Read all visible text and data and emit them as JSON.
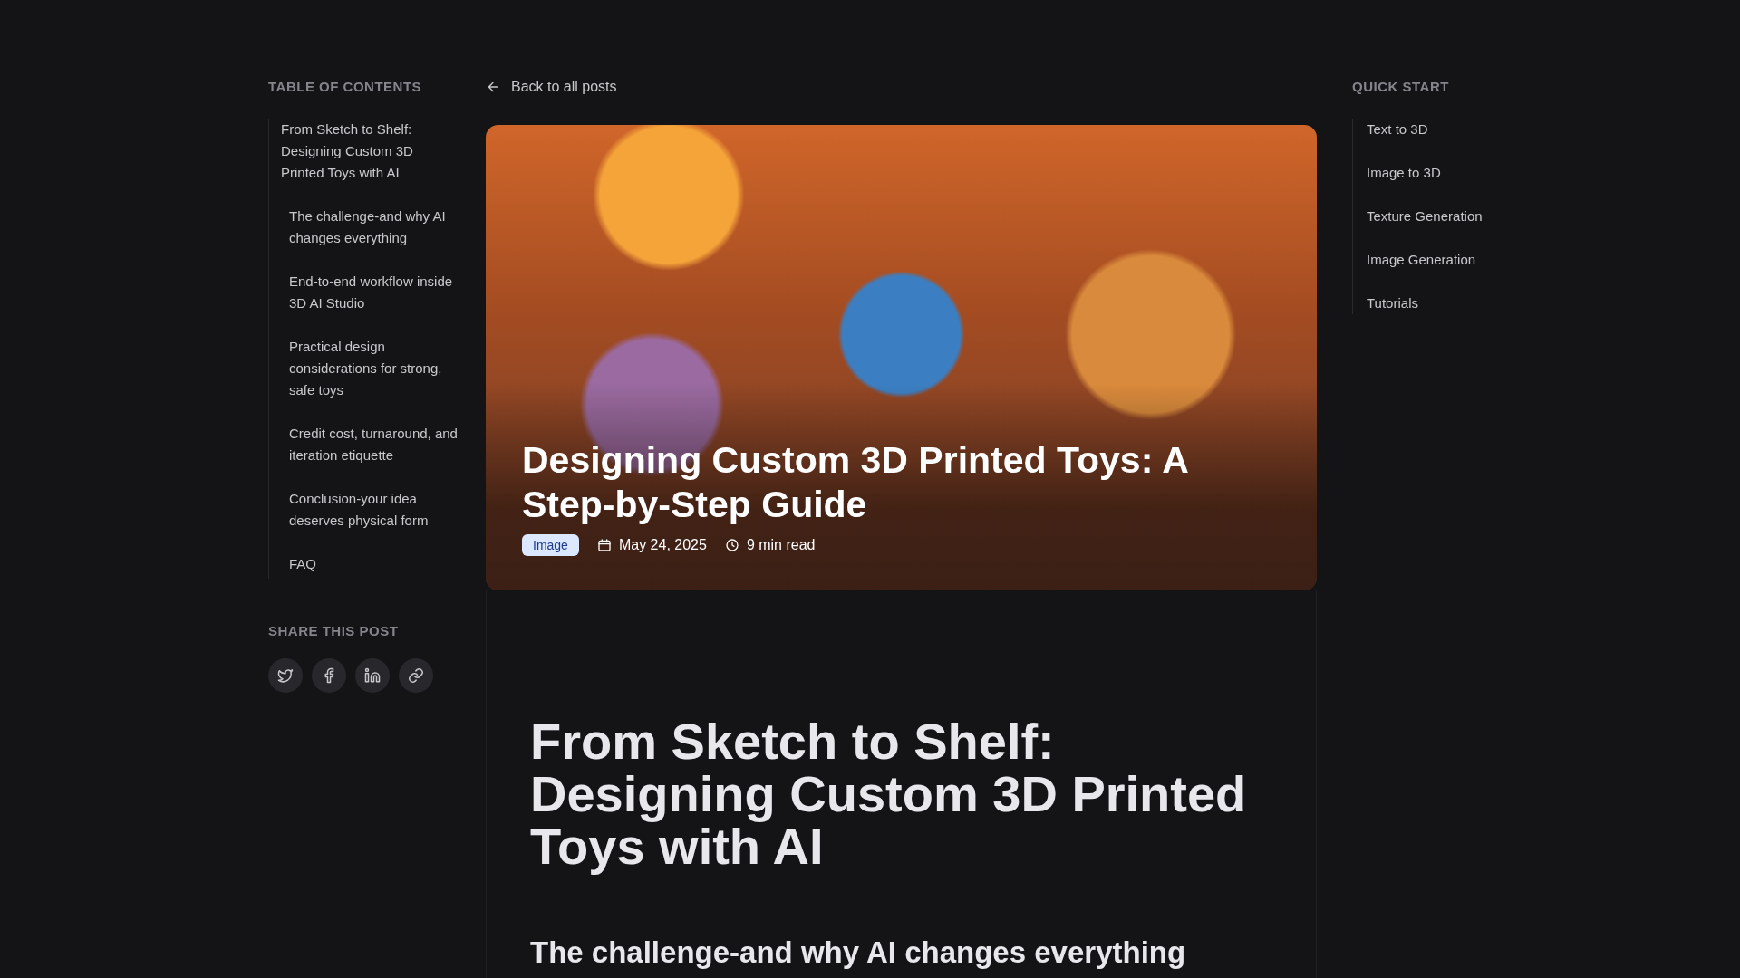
{
  "toc": {
    "title": "TABLE OF CONTENTS",
    "items": [
      {
        "label": "From Sketch to Shelf: Designing Custom 3D Printed Toys with AI",
        "children": [
          {
            "label": "The challenge-and why AI changes everything"
          },
          {
            "label": "End-to-end workflow inside 3D AI Studio"
          },
          {
            "label": "Practical design considerations for strong, safe toys"
          },
          {
            "label": "Credit cost, turnaround, and iteration etiquette"
          },
          {
            "label": "Conclusion-your idea deserves physical form"
          },
          {
            "label": "FAQ"
          }
        ]
      }
    ]
  },
  "share": {
    "title": "SHARE THIS POST",
    "buttons": [
      {
        "kind": "twitter"
      },
      {
        "kind": "facebook"
      },
      {
        "kind": "linkedin"
      },
      {
        "kind": "link"
      }
    ]
  },
  "back_link": "Back to all posts",
  "hero": {
    "title": "Designing Custom 3D Printed Toys: A Step-by-Step Guide",
    "badge": "Image",
    "date": "May 24, 2025",
    "read_time": "9 min read"
  },
  "article": {
    "title": "From Sketch to Shelf: Designing Custom 3D Printed Toys with AI",
    "sections": [
      "The challenge-and why AI changes everything"
    ]
  },
  "quick_start": {
    "title": "QUICK START",
    "items": [
      "Text to 3D",
      "Image to 3D",
      "Texture Generation",
      "Image Generation",
      "Tutorials"
    ]
  }
}
